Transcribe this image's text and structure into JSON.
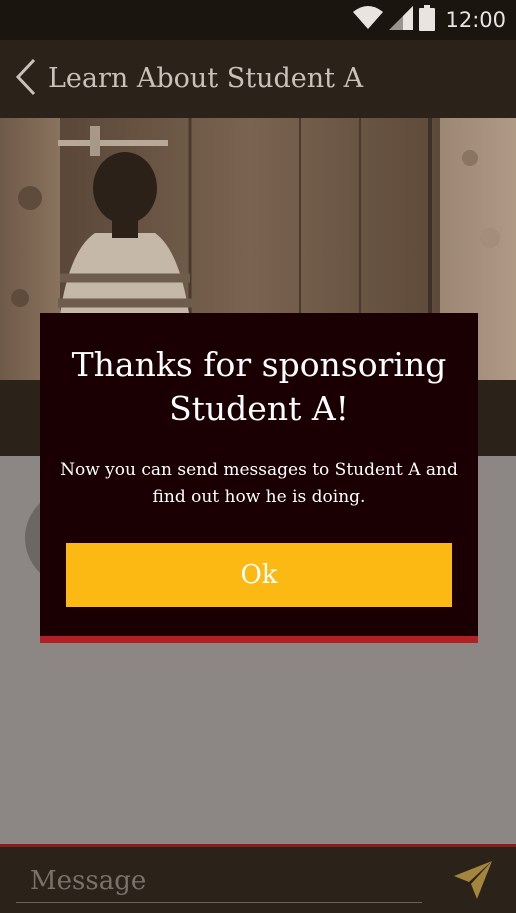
{
  "status_bar": {
    "time": "12:00",
    "icons": [
      "wifi-icon",
      "cell-signal-icon",
      "battery-icon"
    ]
  },
  "app_bar": {
    "title": "Learn About Student A",
    "back_icon": "chevron-left-icon"
  },
  "dialog": {
    "title": "Thanks for sponsoring Student A!",
    "body": "Now you can send messages to Student A and find out how he is doing.",
    "ok_label": "Ok"
  },
  "composer": {
    "placeholder": "Message",
    "send_icon": "send-icon"
  },
  "colors": {
    "app_bar": "#2b221a",
    "dialog_bg": "#1a0002",
    "dialog_accent": "#b21f24",
    "button": "#fdb913",
    "send_icon": "#a4853d"
  }
}
